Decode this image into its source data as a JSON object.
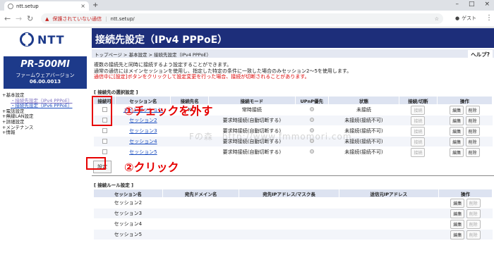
{
  "browser": {
    "tab_title": "ntt.setup",
    "security": "保護されていない通信",
    "url": "ntt.setup/",
    "account": "ゲスト"
  },
  "sidebar": {
    "brand": "NTT",
    "model": "PR-500MI",
    "fw_label": "ファームウェアバージョン",
    "fw_version": "06.00.0013",
    "tree": [
      {
        "label": "基本設定",
        "cls": ""
      },
      {
        "label": "接続先設定（IPv4 PPPoE）",
        "cls": "sub cur"
      },
      {
        "label": "接続先設定（IPv6 PPPoE）",
        "cls": "sub"
      },
      {
        "label": "電話設定",
        "cls": ""
      },
      {
        "label": "無線LAN設定",
        "cls": ""
      },
      {
        "label": "詳細設定",
        "cls": ""
      },
      {
        "label": "メンテナンス",
        "cls": ""
      },
      {
        "label": "情報",
        "cls": ""
      }
    ]
  },
  "page": {
    "title": "接続先設定（IPv4 PPPoE）",
    "breadcrumb": "トップページ > 基本設定 > 接続先設定（IPv4 PPPoE）",
    "help": "ヘルプ?",
    "desc1": "複数の接続先と同時に接続するよう設定することができます。",
    "desc2": "通常の通信にはメインセッションを使用し、指定した特定の条件に一致した場合のみセッション2〜5を使用します。",
    "desc3": "通信中に[設定]ボタンをクリックして設定変更を行った場合、接続が切断されることがあります。"
  },
  "select_section": {
    "title": "[ 接続先の選択設定 ]",
    "headers": [
      "接続可",
      "セッション名",
      "接続先名",
      "接続モード",
      "UPnP優先",
      "状態",
      "接続/切断",
      "操作"
    ],
    "rows": [
      {
        "name": "メインセッション",
        "dest": "N",
        "mode": "常時接続",
        "status": "未接続"
      },
      {
        "name": "セッション2",
        "dest": "",
        "mode": "要求時接続(自動切断する)",
        "status": "未接続(接続不可)"
      },
      {
        "name": "セッション3",
        "dest": "",
        "mode": "要求時接続(自動切断する)",
        "status": "未接続(接続不可)"
      },
      {
        "name": "セッション4",
        "dest": "",
        "mode": "要求時接続(自動切断する)",
        "status": "未接続(接続不可)"
      },
      {
        "name": "セッション5",
        "dest": "",
        "mode": "要求時接続(自動切断する)",
        "status": "未接続(接続不可)"
      }
    ],
    "connect_label": "接続",
    "edit_label": "編集",
    "delete_label": "削除",
    "set_button": "設定"
  },
  "rule_section": {
    "title": "[ 接続ルール設定 ]",
    "headers": [
      "セッション名",
      "宛先ドメイン名",
      "宛先IPアドレス/マスク長",
      "送信元IPアドレス",
      "操作"
    ],
    "rows": [
      "セッション2",
      "セッション3",
      "セッション4",
      "セッション5"
    ]
  },
  "annotations": {
    "step1": "①チェックを外す",
    "step2": "②クリック",
    "watermark": "Fの森　http://www.fmmomori.com"
  }
}
